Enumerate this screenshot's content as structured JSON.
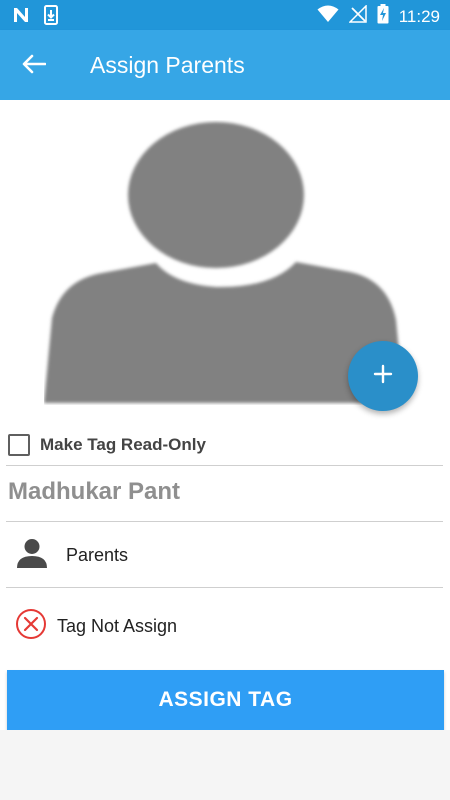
{
  "status_bar": {
    "time": "11:29",
    "icons": [
      "n-notification-icon",
      "download-icon",
      "wifi-icon",
      "no-signal-icon",
      "battery-charging-icon"
    ]
  },
  "app_bar": {
    "title": "Assign Parents",
    "back_icon": "back-arrow-icon"
  },
  "profile": {
    "avatar_icon": "person-silhouette-icon",
    "add_photo_icon": "plus-icon"
  },
  "form": {
    "read_only_label": "Make Tag Read-Only",
    "read_only_checked": false,
    "name_value": "Madhukar Pant",
    "parents_label": "Parents",
    "parents_icon": "person-icon",
    "tag_status_label": "Tag Not Assign",
    "tag_status_icon": "error-circle-icon"
  },
  "actions": {
    "assign_label": "ASSIGN TAG"
  },
  "colors": {
    "status_bar": "#2196d9",
    "app_bar": "#36a6e6",
    "fab": "#2a8fc9",
    "assign_button": "#2f9ef5",
    "error": "#e53935"
  }
}
